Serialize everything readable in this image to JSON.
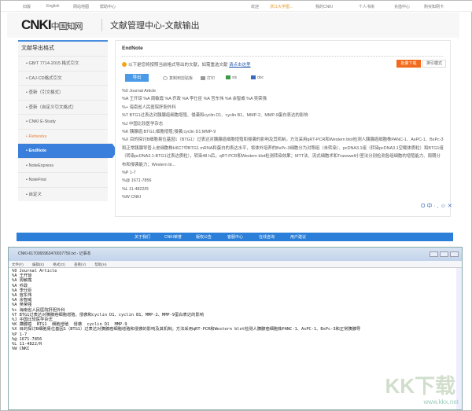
{
  "topbar": {
    "links": [
      "旧版",
      "English",
      "网站地图",
      "帮助中心"
    ],
    "welcome": "欢迎",
    "user": "浙江大学图...",
    "mycnki": "我的CNKI",
    "personal": "个人书房",
    "recharge": "充值中心",
    "service": "购买知网卡"
  },
  "header": {
    "logo": "CNKI",
    "logo_cn": "中国知网",
    "title": "文献管理中心-文献输出"
  },
  "sidebar": {
    "title": "文献导出格式",
    "items": [
      "GB/T 7714-2015 格式引文",
      "CAJ-CD格式引文",
      "查新（引文格式）",
      "查新（自定义引文格式）",
      "CNKI E-Study",
      "Refworks",
      "EndNote",
      "NoteExpress",
      "NoteFirst",
      "自定义"
    ]
  },
  "panel": {
    "title": "EndNote",
    "notice": "以下是您将按照当前格式导出的文献，如需重选文献",
    "notice_link": "请点击这里",
    "btn_orange": "批量下载",
    "btn_gray": "排引模式",
    "export": "导出",
    "tools": [
      "复制到剪贴板",
      "打印",
      "xls",
      "doc"
    ],
    "lines": [
      "%0 Journal Article",
      "%A 王开琼 %A 周敏霞 %A 乔政 %A 李仕臣 %A 宫东伟 %A 余智威 %A 吴荣强",
      "%+ 海南省人民医院肝胆外科",
      "%T BTG1过表达对胰腺癌细胞增殖、侵袭和cyclin D1、cyclin B1、MMP-2、MMP-9蛋白表达的影响",
      "%J 中国比较医学杂志",
      "%K 胰腺癌;BTG1;细胞增殖;侵袭;cyclin D1;MMP-9",
      "%X 目的探讨B细胞易位基因1（BTG1）过表达对胰腺癌细胞增殖和侵袭的影响及其机制。方法采用qRT-PCR和Western blot检测人胰腺癌细胞株PANC-1、AsPC-1、BxPc-3和正常胰腺导管上皮细胞株H6C7中BTG1 mRNA和蛋白的表达水平，将体外培养的BxPc-3细胞分为对照组（未转染）、pcDNA3.1组（转染pcDNA3.1空载体质粒）和BTG1组（转染pcDNA3.1-BTG1过表达质粒），转染48 h后，qRT-PCR和Western blot检测转染效果；MTT法、流式细胞术和Transwell小室法分别检测各组细胞的增殖能力、周期分布和侵袭能力；Western bl...",
      "%P 1-7",
      "%@ 1671-7856",
      "%L 11-4822/R",
      "%W CNKI"
    ]
  },
  "float_icons": "O中·,☺✕",
  "footer_nav": [
    "关于我们",
    "CNKI荣誉",
    "版权公告",
    "客服中心",
    "在线咨询",
    "用户建议"
  ],
  "notepad": {
    "title": "CNKI-6170365963470037750.txt - 记事本",
    "menu": [
      "文件(F)",
      "编辑(E)",
      "格式(O)",
      "查看(V)",
      "帮助(H)"
    ],
    "body": "%0 Journal Article\n%A 王开琼\n%A 周敏霞\n%A 乔政\n%A 李仕臣\n%A 宫东伟\n%A 余智威\n%A 吴荣强\n%+ 海南省人民医院肝胆外科\n%T BTG1过表达对胰腺癌细胞增殖、侵袭和cyclin D1、cyclin B1、MMP-2、MMP-9蛋白表达的影响\n%J 中国比较医学杂志\n%K 胰腺癌  BTG1  细胞增殖  侵袭  cyclin D1  MMP-9\n%X 目的探讨B细胞易位基因1（BTG1）过表达对胰腺癌细胞增殖和侵袭的影响及其机制。方法采用qRT-PCR和Western blot检测人胰腺癌细胞株PANC-1、AsPC-1、BxPc-3和正常胰腺导\n%P 1-7\n%@ 1671-7856\n%L 11-4822/R\n%W CNKI"
  },
  "watermark": "KK下载",
  "watermark_url": "www.kkx.net"
}
